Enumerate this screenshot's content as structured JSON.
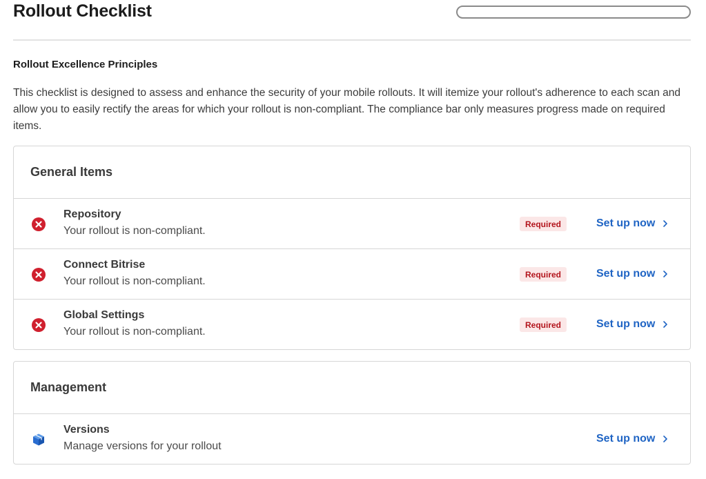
{
  "header": {
    "title": "Rollout Checklist",
    "compliance_progress": 0
  },
  "principles": {
    "heading": "Rollout Excellence Principles",
    "description": "This checklist is designed to assess and enhance the security of your mobile rollouts. It will itemize your rollout's adherence to each scan and allow you to easily rectify the areas for which your rollout is non-compliant. The compliance bar only measures progress made on required items."
  },
  "general": {
    "title": "General Items",
    "items": [
      {
        "title": "Repository",
        "status": "Your rollout is non-compliant.",
        "badge": "Required",
        "action": "Set up now",
        "icon": "error-x-icon"
      },
      {
        "title": "Connect Bitrise",
        "status": "Your rollout is non-compliant.",
        "badge": "Required",
        "action": "Set up now",
        "icon": "error-x-icon"
      },
      {
        "title": "Global Settings",
        "status": "Your rollout is non-compliant.",
        "badge": "Required",
        "action": "Set up now",
        "icon": "error-x-icon"
      }
    ]
  },
  "management": {
    "title": "Management",
    "items": [
      {
        "title": "Versions",
        "status": "Manage versions for your rollout",
        "action": "Set up now",
        "icon": "box-icon"
      }
    ]
  },
  "colors": {
    "error": "#d0202e",
    "link": "#1f64c4",
    "badge_bg": "#fbe7e7",
    "badge_text": "#b3141c"
  }
}
